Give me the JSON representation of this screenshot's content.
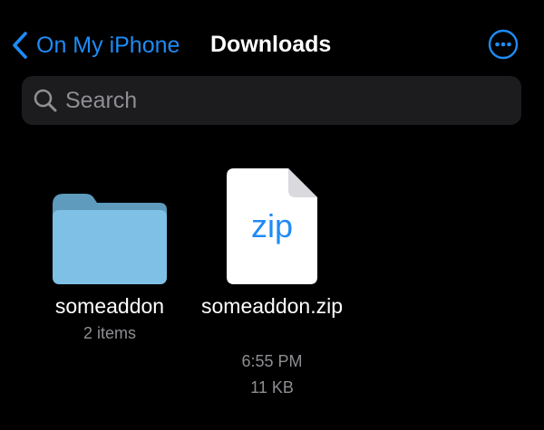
{
  "nav": {
    "back_label": "On My iPhone",
    "title": "Downloads",
    "icons": {
      "back": "chevron-left-icon",
      "more": "ellipsis-circle-icon"
    }
  },
  "search": {
    "placeholder": "Search",
    "value": "",
    "icon": "search-icon"
  },
  "items": [
    {
      "kind": "folder",
      "icon": "folder-icon",
      "name": "someaddon",
      "meta": "2 items"
    },
    {
      "kind": "file",
      "icon": "zip-file-icon",
      "badge": "zip",
      "name": "someaddon.zip",
      "time": "6:55 PM",
      "size": "11 KB"
    }
  ],
  "colors": {
    "accent": "#1E8BF5",
    "background": "#000000",
    "search_field": "#1C1C1E",
    "secondary_text": "#8E8E93",
    "folder": "#7EC0E6",
    "folder_tab": "#5E9BBC"
  }
}
